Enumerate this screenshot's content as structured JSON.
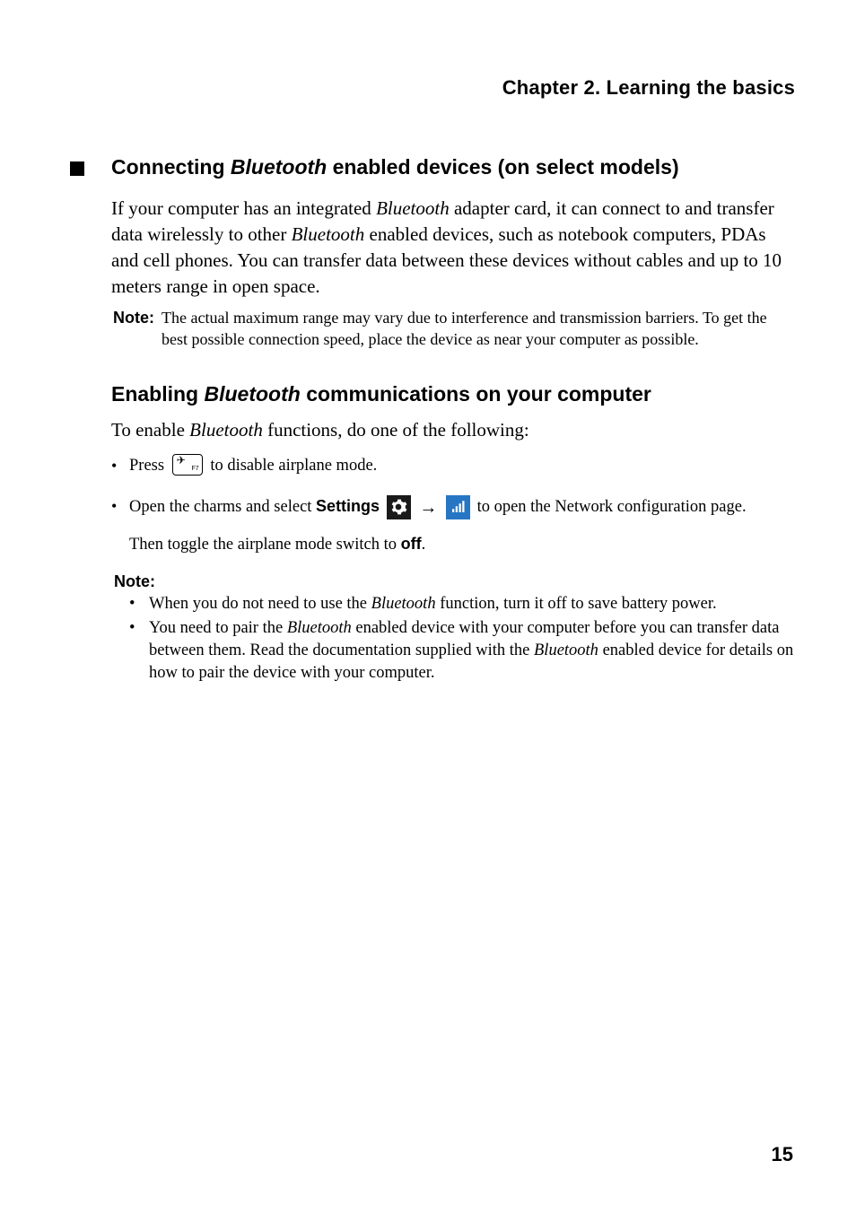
{
  "chapterTitle": "Chapter 2. Learning the basics",
  "section": {
    "title_pre": "Connecting ",
    "title_em": "Bluetooth",
    "title_post": " enabled devices (on select models)"
  },
  "intro": {
    "seg1": "If your computer has an integrated ",
    "em1": "Bluetooth",
    "seg2": " adapter card, it can connect to and transfer data wirelessly to other ",
    "em2": "Bluetooth",
    "seg3": " enabled devices, such as notebook computers, PDAs and cell phones. You can transfer data between these devices without cables and up to 10 meters range in open space."
  },
  "note1": {
    "label": "Note:",
    "text": "The actual maximum range may vary due to interference and transmission barriers. To get the best possible connection speed, place the device as near your computer as possible."
  },
  "subheading": {
    "pre": "Enabling ",
    "em": "Bluetooth",
    "post": " communications on your computer"
  },
  "lead": {
    "seg1": "To enable ",
    "em": "Bluetooth",
    "seg2": " functions, do one of the following:"
  },
  "bullets": {
    "b1_pre": "Press ",
    "b1_post": " to disable airplane mode.",
    "b2_pre": "Open the charms and select ",
    "b2_bold": "Settings",
    "b2_post": " to open the Network configuration page.",
    "b2_then_pre": "Then toggle the airplane mode switch to ",
    "b2_then_bold": "off",
    "b2_then_post": "."
  },
  "note2": {
    "label": "Note:",
    "item1_pre": "When you do not need to use the ",
    "item1_em": "Bluetooth",
    "item1_post": " function, turn it off to save battery power.",
    "item2_pre": "You need to pair the ",
    "item2_em1": "Bluetooth",
    "item2_mid": " enabled device with your computer before you can transfer data between them. Read the documentation supplied with the ",
    "item2_em2": "Bluetooth",
    "item2_post": " enabled device for details on how to pair the device with your computer."
  },
  "pageNumber": "15"
}
